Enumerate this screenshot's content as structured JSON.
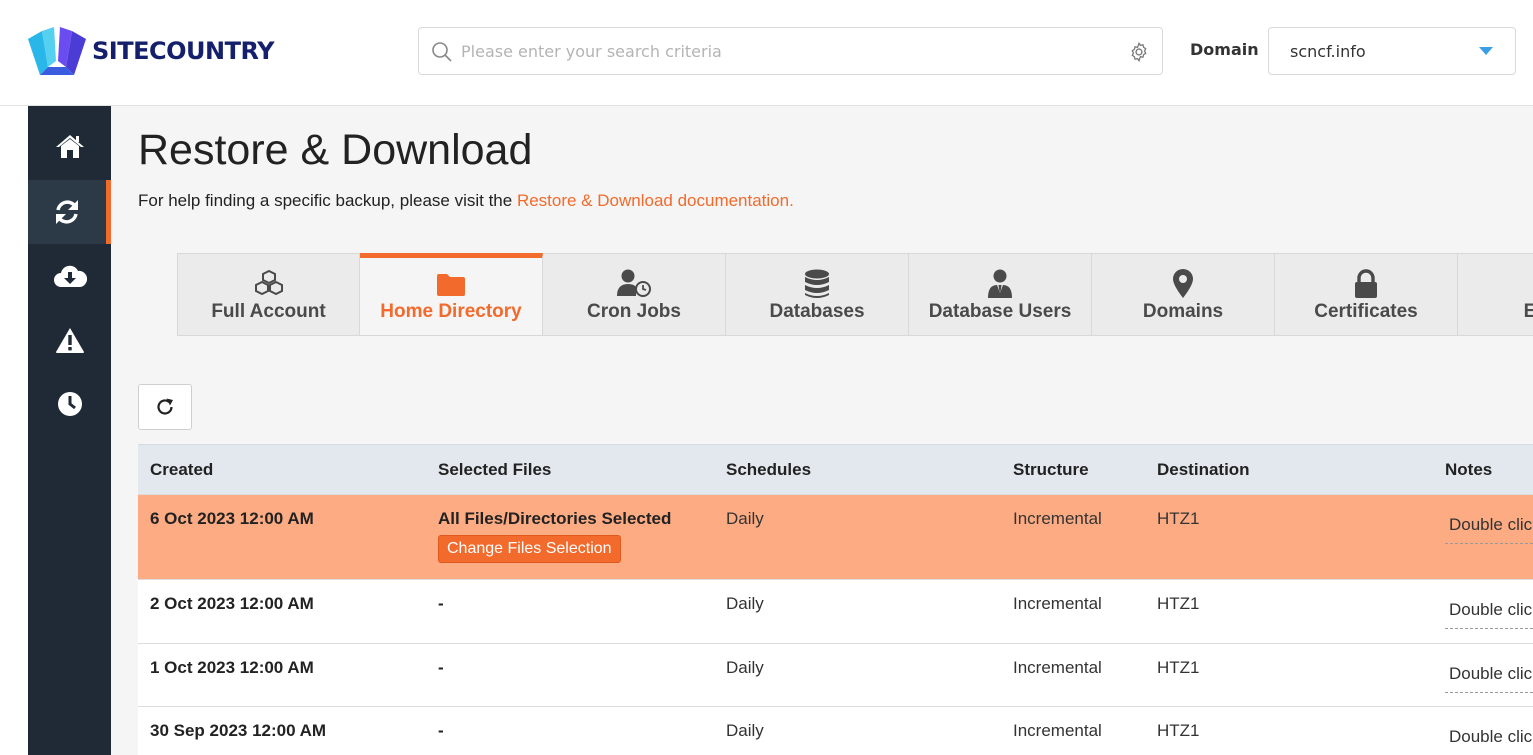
{
  "header": {
    "logo_text": "SITECOUNTRY",
    "search_placeholder": "Please enter your search criteria",
    "domain_label": "Domain",
    "domain_value": "scncf.info"
  },
  "sidebar": {
    "items": [
      {
        "icon": "home-icon"
      },
      {
        "icon": "sync-icon",
        "active": true
      },
      {
        "icon": "cloud-download-icon"
      },
      {
        "icon": "warning-icon"
      },
      {
        "icon": "clock-icon"
      }
    ]
  },
  "page": {
    "title": "Restore & Download",
    "help_prefix": "For help finding a specific backup, please visit the ",
    "help_link": "Restore & Download documentation."
  },
  "tabs": [
    {
      "label": "Full Account",
      "icon": "cubes-icon"
    },
    {
      "label": "Home Directory",
      "icon": "folder-icon",
      "active": true
    },
    {
      "label": "Cron Jobs",
      "icon": "user-clock-icon"
    },
    {
      "label": "Databases",
      "icon": "database-icon"
    },
    {
      "label": "Database Users",
      "icon": "user-tie-icon"
    },
    {
      "label": "Domains",
      "icon": "map-marker-icon"
    },
    {
      "label": "Certificates",
      "icon": "lock-icon"
    },
    {
      "label": "Email",
      "icon": "envelope-icon"
    }
  ],
  "table": {
    "columns": [
      "Created",
      "Selected Files",
      "Schedules",
      "Structure",
      "Destination",
      "Notes"
    ],
    "rows": [
      {
        "created": "6 Oct 2023 12:00 AM",
        "files": "All Files/Directories Selected",
        "action": "Change Files Selection",
        "schedule": "Daily",
        "structure": "Incremental",
        "destination": "HTZ1",
        "notes": "Double click to add notes"
      },
      {
        "created": "2 Oct 2023 12:00 AM",
        "files": "-",
        "schedule": "Daily",
        "structure": "Incremental",
        "destination": "HTZ1",
        "notes": "Double click to add notes"
      },
      {
        "created": "1 Oct 2023 12:00 AM",
        "files": "-",
        "schedule": "Daily",
        "structure": "Incremental",
        "destination": "HTZ1",
        "notes": "Double click to add notes"
      },
      {
        "created": "30 Sep 2023 12:00 AM",
        "files": "-",
        "schedule": "Daily",
        "structure": "Incremental",
        "destination": "HTZ1",
        "notes": "Double click to add notes"
      }
    ]
  },
  "colors": {
    "accent": "#f26a2c",
    "selected_row": "#fdab83",
    "sidebar": "#1f2a36",
    "logo_text": "#14206b"
  }
}
